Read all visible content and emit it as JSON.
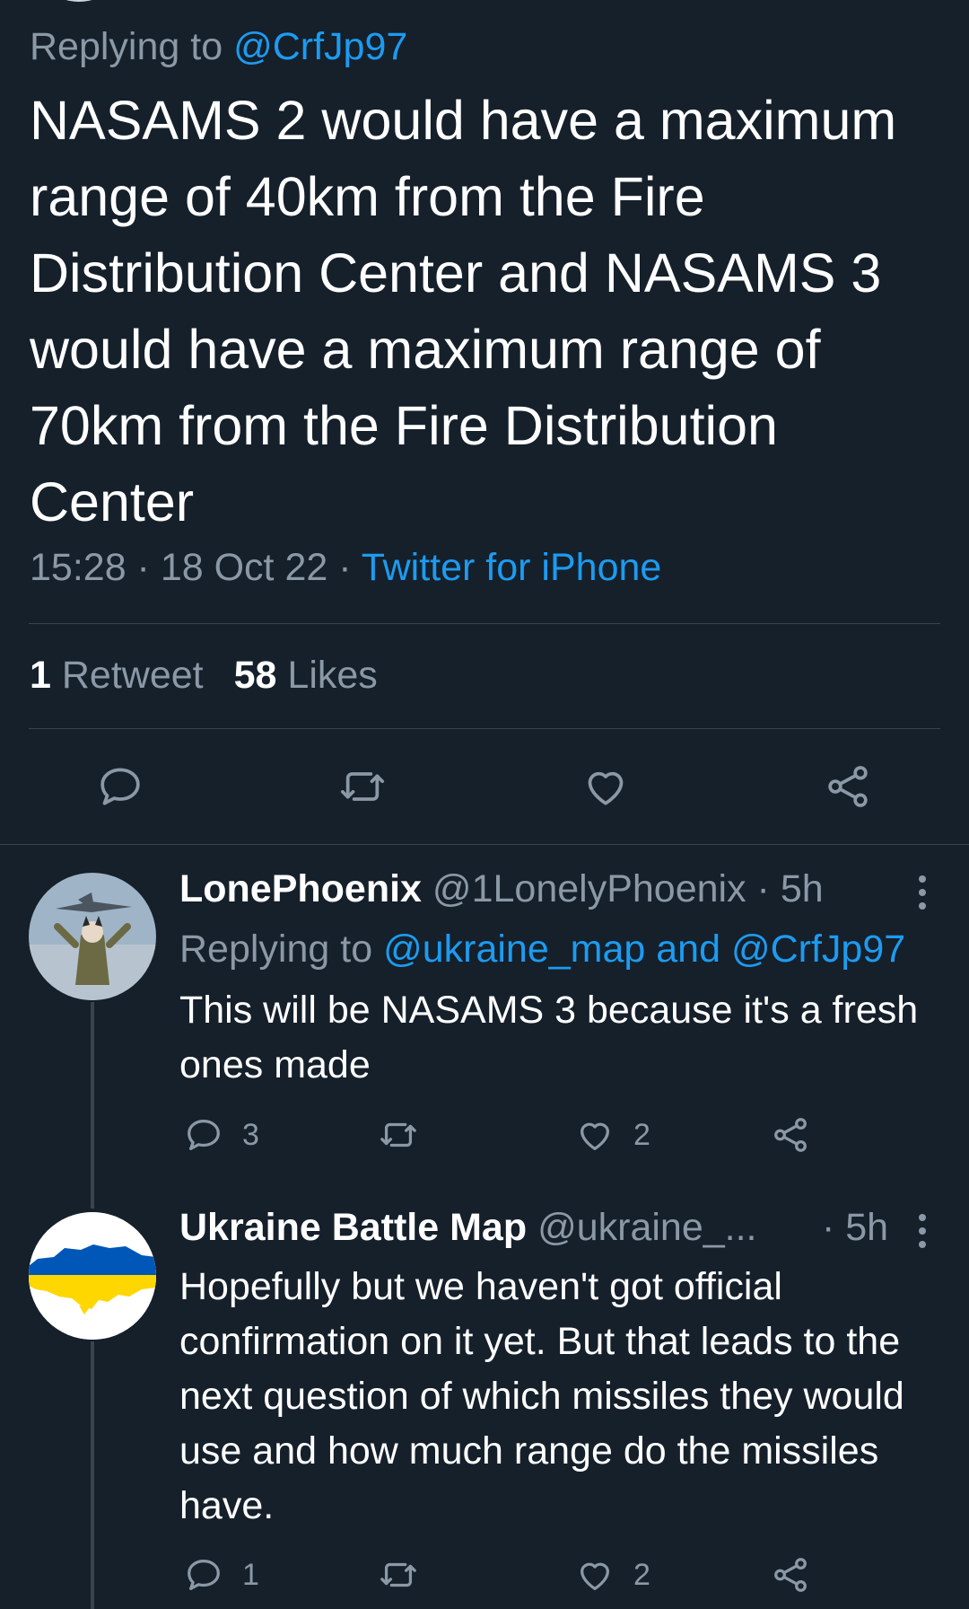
{
  "main_tweet": {
    "replying_prefix": "Replying to ",
    "replying_handle": "@CrfJp97",
    "text": "NASAMS 2 would have a maximum range of 40km from the Fire Distribution Center and NASAMS 3 would have a maximum range of 70km from the Fire Distribution Center",
    "time": "15:28",
    "date": "18 Oct 22",
    "source": "Twitter for iPhone",
    "separator": " · ",
    "retweet_count": "1",
    "retweet_label": "Retweet",
    "likes_count": "58",
    "likes_label": "Likes",
    "actions": [
      "reply-icon",
      "retweet-icon",
      "like-icon",
      "share-icon"
    ]
  },
  "replies": [
    {
      "name": "LonePhoenix",
      "handle": "@1LonelyPhoenix",
      "time": "· 5h",
      "replying_prefix": "Replying to ",
      "replying_to": "@ukraine_map and @CrfJp97",
      "text": "This will be NASAMS 3 because it's a fresh ones made",
      "reply_count": "3",
      "retweet_count": "",
      "like_count": "2"
    },
    {
      "name": "Ukraine Battle Map",
      "handle": "@ukraine_...",
      "time": "· 5h",
      "text": "Hopefully but we haven't got official confirmation on it yet. But that leads to the next question of which missiles they would use and how much range do the missiles have.",
      "reply_count": "1",
      "retweet_count": "",
      "like_count": "2"
    }
  ],
  "colors": {
    "background": "#15202b",
    "accent": "#1d9bf0",
    "muted": "#8b98a5",
    "divider": "#38444d",
    "flag_blue": "#0057b7",
    "flag_yellow": "#ffd700"
  }
}
